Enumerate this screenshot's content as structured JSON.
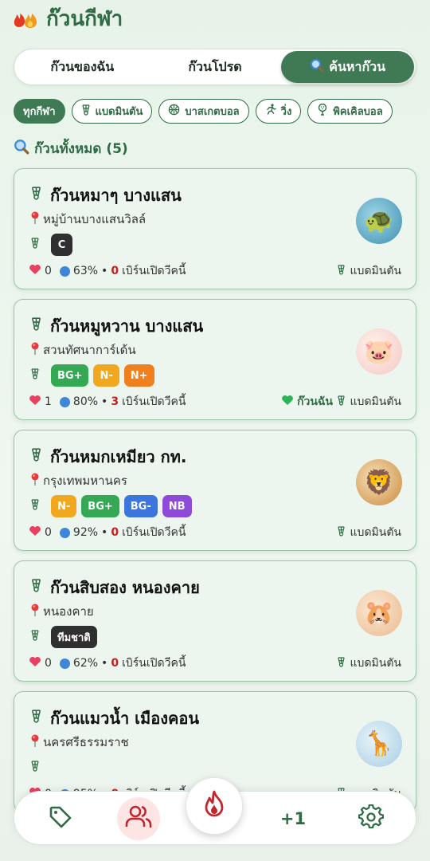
{
  "header": {
    "title": "ก๊วนกีฬา"
  },
  "tabs": [
    {
      "label": "ก๊วนของฉัน"
    },
    {
      "label": "ก๊วนโปรด"
    },
    {
      "label": "ค้นหาก๊วน"
    }
  ],
  "filters": [
    {
      "label": "ทุกกีฬา"
    },
    {
      "label": "แบดมินตัน"
    },
    {
      "label": "บาสเกตบอล"
    },
    {
      "label": "วิ่ง"
    },
    {
      "label": "พิคเคิลบอล"
    }
  ],
  "section": {
    "title": "ก๊วนทั้งหมด (5)"
  },
  "colors": {
    "accent": "#3f7a55",
    "badge_c": "#2f2f2f",
    "badge_bg_plus": "#34a853",
    "badge_n": "#f2a81e",
    "badge_n_plus": "#f07f1e",
    "badge_bg_minus": "#3a76dd",
    "badge_nb": "#8e4bd9"
  },
  "groups": [
    {
      "name": "ก๊วนหมาๆ บางแสน",
      "location": "หมู่บ้านบางแสนวิลล์",
      "badges": [
        "C"
      ],
      "likes": "0",
      "percent": "63%",
      "separator": "•",
      "burns": "0",
      "burns_text": "เบิร์นเปิดวีคนี้",
      "sport": "แบดมินตัน",
      "avatar_icon": "turtle-icon"
    },
    {
      "name": "ก๊วนหมูหวาน บางแสน",
      "location": "สวนทัศนาการ์เด้น",
      "badges": [
        "BG+",
        "N-",
        "N+"
      ],
      "likes": "1",
      "percent": "80%",
      "separator": "•",
      "burns": "3",
      "burns_text": "เบิร์นเปิดวีคนี้",
      "my_group": "ก๊วนฉัน",
      "sport": "แบดมินตัน",
      "avatar_icon": "pig-icon"
    },
    {
      "name": "ก๊วนหมกเหมียว กท.",
      "location": "กรุงเทพมหานคร",
      "badges": [
        "N-",
        "BG+",
        "BG-",
        "NB"
      ],
      "likes": "0",
      "percent": "92%",
      "separator": "•",
      "burns": "0",
      "burns_text": "เบิร์นเปิดวีคนี้",
      "sport": "แบดมินตัน",
      "avatar_icon": "lion-icon"
    },
    {
      "name": "ก๊วนสิบสอง หนองคาย",
      "location": "หนองคาย",
      "badges": [
        "ทีมชาติ"
      ],
      "likes": "0",
      "percent": "62%",
      "separator": "•",
      "burns": "0",
      "burns_text": "เบิร์นเปิดวีคนี้",
      "sport": "แบดมินตัน",
      "avatar_icon": "hamster-icon"
    },
    {
      "name": "ก๊วนแมวน้ำ เมืองคอน",
      "location": "นครศรีธรรมราช",
      "badges": [],
      "likes": "0",
      "percent": "95%",
      "separator": "•",
      "burns": "0",
      "burns_text": "เบิร์นเปิดวีคนี้",
      "sport": "แบดมินตัน",
      "avatar_icon": "giraffe-icon"
    }
  ],
  "bottom_nav": {
    "plus_label": "+1"
  }
}
